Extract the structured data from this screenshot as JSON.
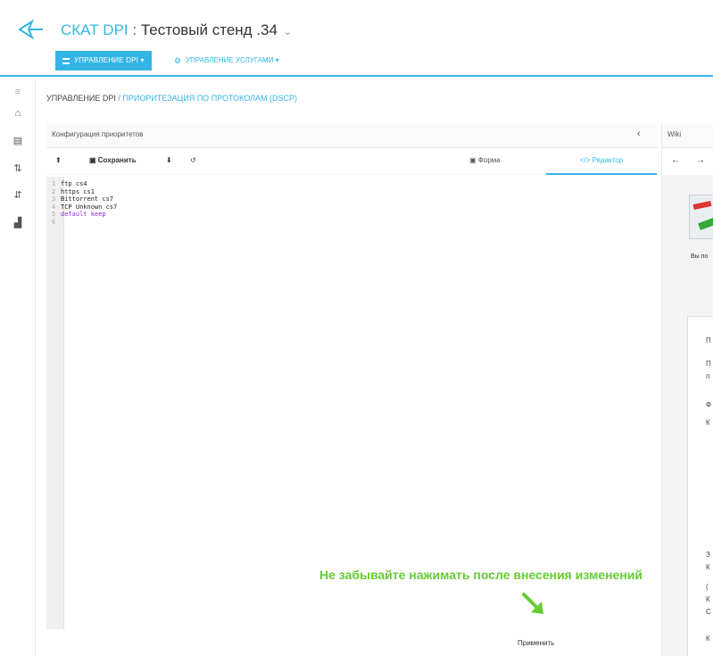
{
  "header": {
    "app_name": "СКАТ DPI",
    "separator": ":",
    "stand_name": "Тестовый стенд .34",
    "stand_caret": "⌄",
    "nav_primary_label": "Управление DPI ▾",
    "nav_secondary_label": "Управление услугами ▾"
  },
  "sidebar": {
    "items": [
      {
        "icon": "menu-icon",
        "glyph": "≡"
      },
      {
        "icon": "home-icon",
        "glyph": "⌂"
      },
      {
        "icon": "server-icon",
        "glyph": "▤"
      },
      {
        "icon": "sort-icon",
        "glyph": "⇅"
      },
      {
        "icon": "sort-alt-icon",
        "glyph": "⇵"
      },
      {
        "icon": "chart-icon",
        "glyph": "▟"
      }
    ]
  },
  "breadcrumb": {
    "root": "Управление DPI",
    "slash": "/",
    "current": "Приоритезация по протоколам (DSCP)"
  },
  "panel": {
    "title": "Конфигурация приоритетов",
    "collapse_glyph": "‹",
    "toolbar": {
      "upload_glyph": "⬆",
      "save_label": "Сохранить",
      "download_glyph": "⬇",
      "undo_glyph": "↺",
      "form_tab": "Форма",
      "editor_tab": "Редактор"
    }
  },
  "editor": {
    "lines": [
      {
        "n": "1",
        "text": "ftp cs4",
        "kw": false
      },
      {
        "n": "2",
        "text": "https cs1",
        "kw": false
      },
      {
        "n": "3",
        "text": "Bittorrent cs7",
        "kw": false
      },
      {
        "n": "4",
        "text": "TCP Unknown cs7",
        "kw": false
      },
      {
        "n": "5",
        "text": "default keep",
        "kw": true
      },
      {
        "n": "6",
        "text": "",
        "kw": false
      }
    ]
  },
  "wiki": {
    "title": "Wiki",
    "back_glyph": "←",
    "forward_glyph": "→",
    "caption": "Вы по",
    "side_letters": [
      "П",
      "П",
      "п",
      "Ф",
      "К",
      "З",
      "К",
      "(",
      "К",
      "С",
      "К"
    ]
  },
  "hint": "Не забывайте нажимать после внесения изменений",
  "apply_label": "Применить",
  "colors": {
    "accent": "#33b5e5",
    "hint_green": "#66cc33",
    "keyword": "#8a2be2"
  }
}
